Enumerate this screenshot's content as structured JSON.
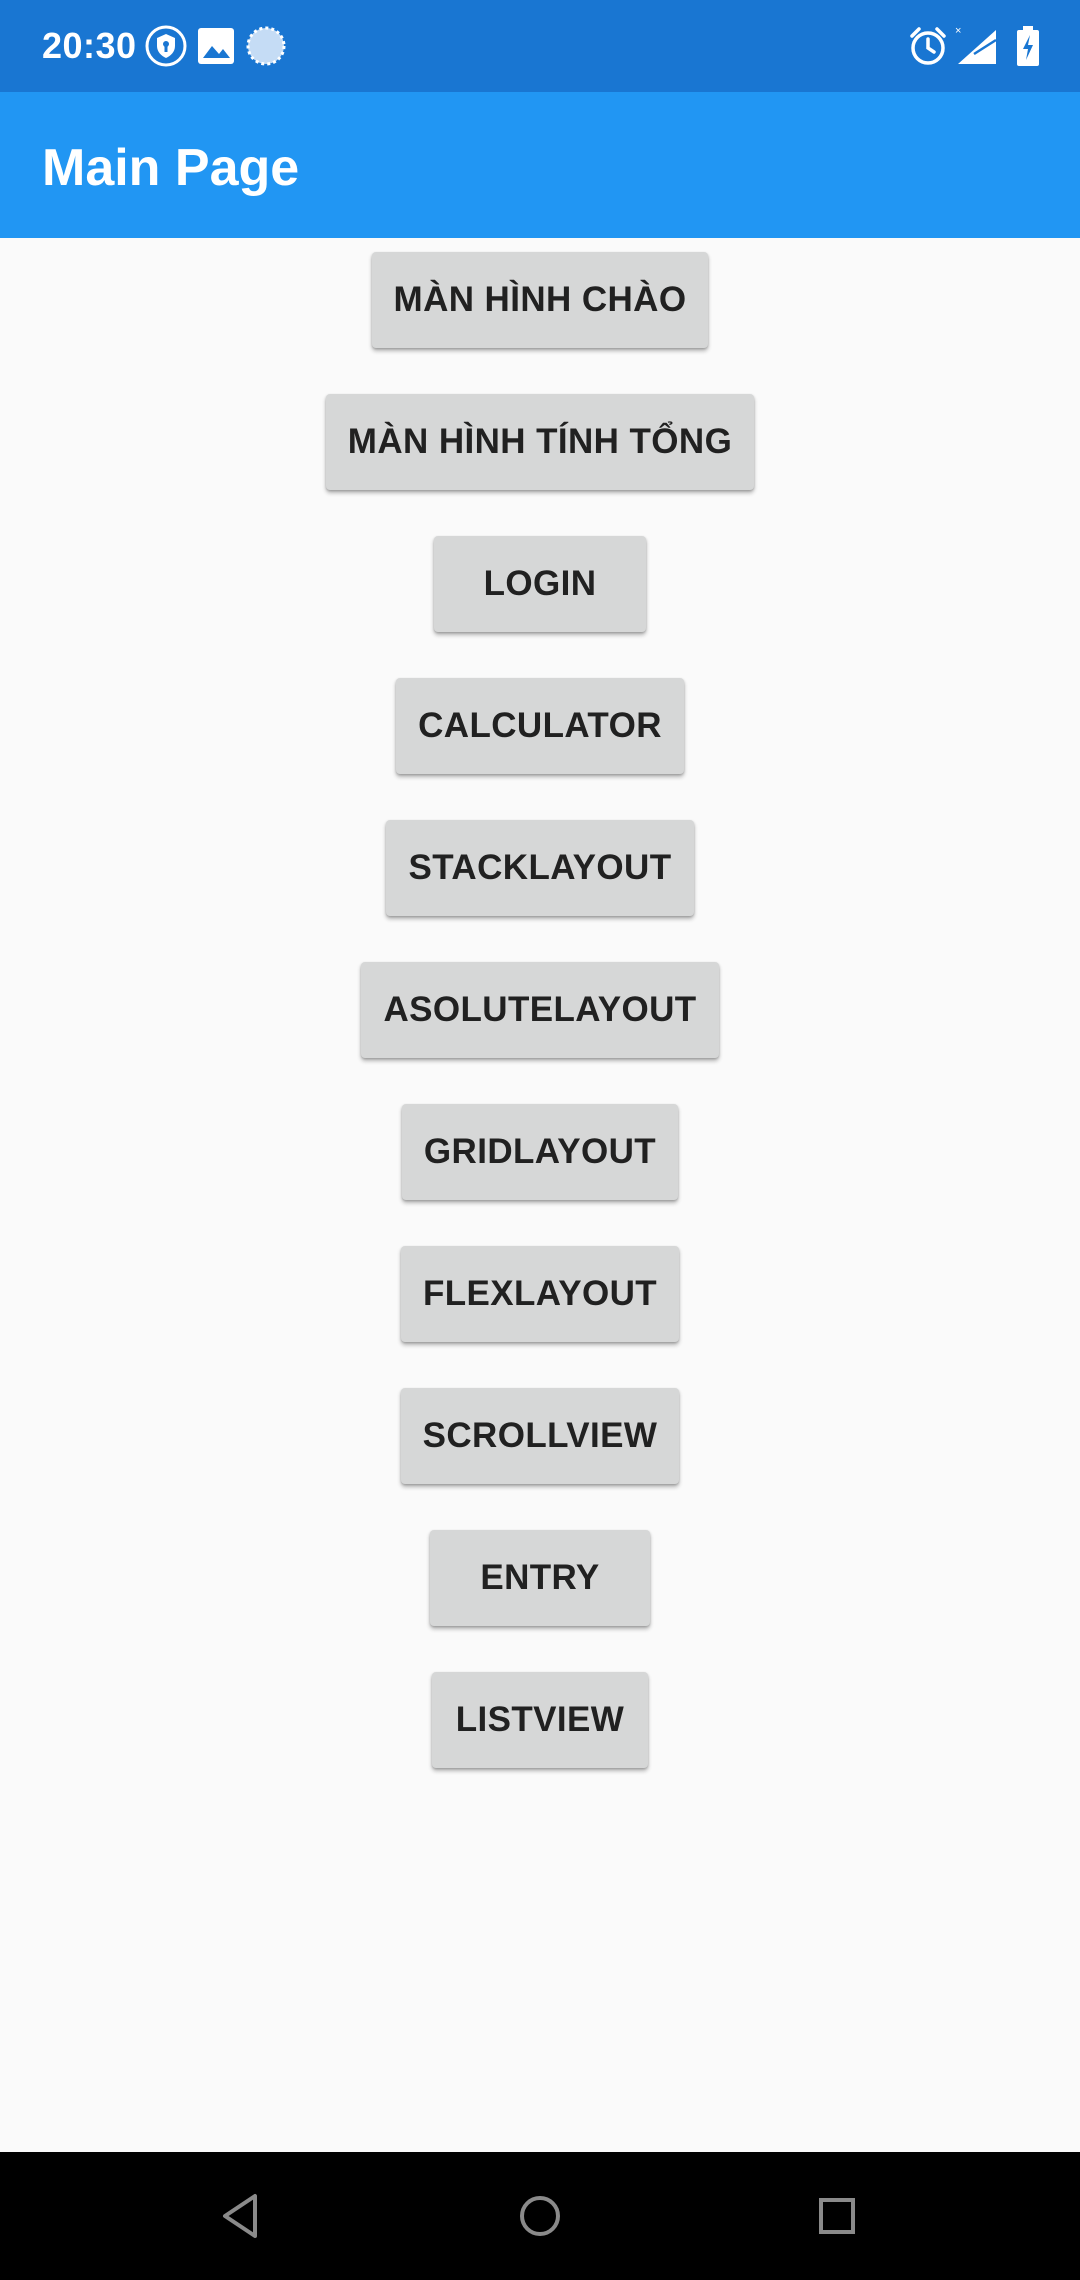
{
  "status_bar": {
    "time": "20:30",
    "icons": [
      "shield-icon",
      "image-icon",
      "loading-icon",
      "alarm-icon",
      "signal-icon",
      "battery-icon"
    ],
    "background": "#1976d2"
  },
  "app_bar": {
    "title": "Main Page",
    "background": "#2196f3"
  },
  "buttons": [
    "MÀN HÌNH CHÀO",
    "MÀN HÌNH TÍNH TỔNG",
    "LOGIN",
    "CALCULATOR",
    "STACKLAYOUT",
    "ASOLUTELAYOUT",
    "GRIDLAYOUT",
    "FLEXLAYOUT",
    "SCROLLVIEW",
    "ENTRY",
    "LISTVIEW"
  ],
  "nav_bar": {
    "icons": [
      "back-icon",
      "home-icon",
      "recents-icon"
    ]
  }
}
